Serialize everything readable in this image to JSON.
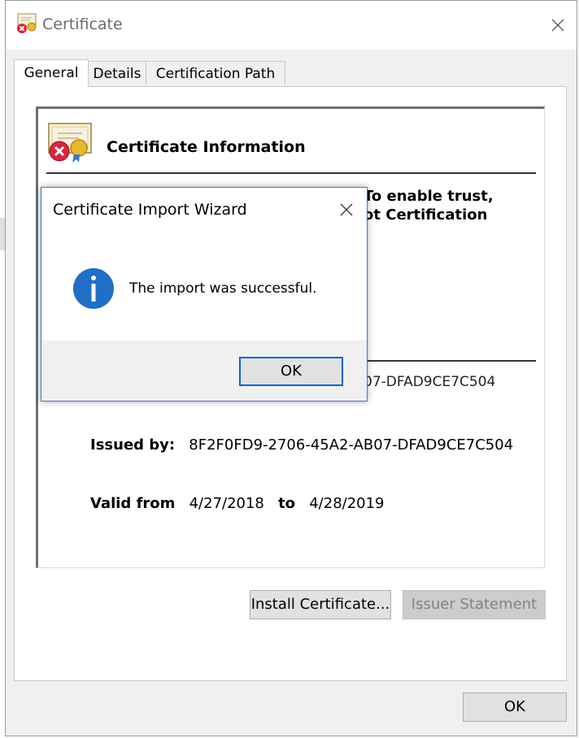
{
  "window": {
    "title": "Certificate",
    "close_glyph": "✕"
  },
  "tabs": [
    {
      "label": "General"
    },
    {
      "label": "Details"
    },
    {
      "label": "Certification Path"
    }
  ],
  "general": {
    "info_title": "Certificate Information",
    "partial_line_1": "To enable trust,",
    "partial_line_2": "ot Certification",
    "serial_fragment": "07-DFAD9CE7C504",
    "issued_by_label": "Issued by:",
    "issued_by_value": "8F2F0FD9-2706-45A2-AB07-DFAD9CE7C504",
    "valid_from_label": "Valid from",
    "valid_from_value": "4/27/2018",
    "to_label": "to",
    "valid_to_value": "4/28/2019",
    "install_button": "Install Certificate...",
    "issuer_statement_button": "Issuer Statement"
  },
  "footer": {
    "ok_label": "OK"
  },
  "dialog": {
    "title": "Certificate Import Wizard",
    "message": "The import was successful.",
    "ok_label": "OK",
    "close_glyph": "✕"
  },
  "icons": {
    "window_icon": "certificate-error-icon",
    "info_icon": "certificate-error-icon",
    "dialog_icon": "information-icon"
  },
  "colors": {
    "accent": "#0a64c8",
    "info_blue": "#1f6fc6",
    "error_red": "#d7263d"
  }
}
